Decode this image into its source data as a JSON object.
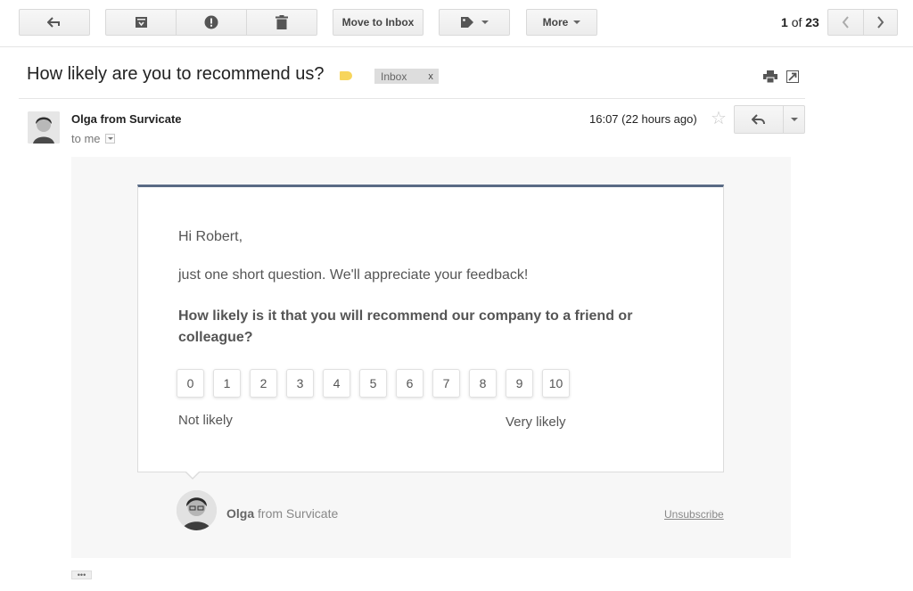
{
  "toolbar": {
    "back_icon": "arrow-back-icon",
    "archive_icon": "archive-icon",
    "spam_icon": "report-spam-icon",
    "delete_icon": "trash-icon",
    "move_to_inbox": "Move to Inbox",
    "labels_icon": "tag-icon",
    "more": "More",
    "pager_current": "1",
    "pager_of": "of",
    "pager_total": "23"
  },
  "message": {
    "subject": "How likely are you to recommend us?",
    "label_chip": "Inbox",
    "label_chip_close": "x",
    "sender": "Olga from Survicate",
    "to": "to me",
    "time": "16:07 (22 hours ago)"
  },
  "survey": {
    "greeting": "Hi Robert,",
    "intro": "just one short question. We'll appreciate your feedback!",
    "question": "How likely is it that you will recommend our company to a friend or colleague?",
    "scores": [
      "0",
      "1",
      "2",
      "3",
      "4",
      "5",
      "6",
      "7",
      "8",
      "9",
      "10"
    ],
    "low_label": "Not likely",
    "high_label": "Very likely",
    "sig_name": "Olga",
    "sig_rest": " from Survicate",
    "unsubscribe": "Unsubscribe"
  },
  "colors": {
    "accent_bar": "#5a6b85",
    "label_yellow": "#f7d55c"
  }
}
